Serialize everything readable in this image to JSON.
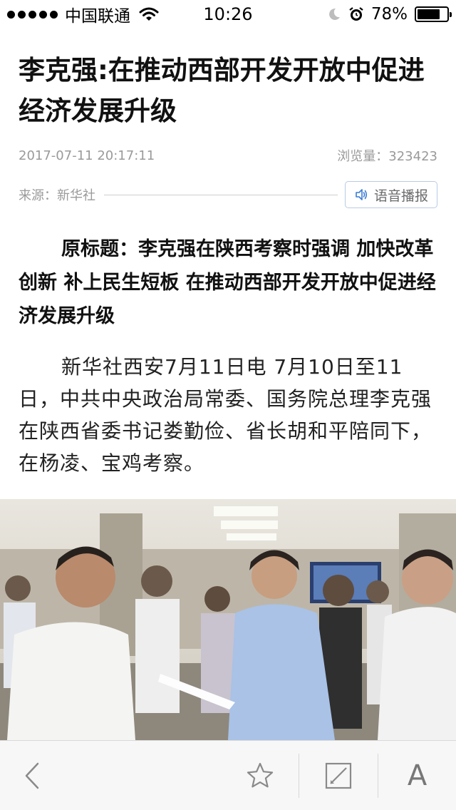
{
  "status_bar": {
    "carrier": "中国联通",
    "time": "10:26",
    "battery_percent": "78%",
    "battery_level": 0.78
  },
  "article": {
    "title": "李克强:在推动西部开发开放中促进经济发展升级",
    "datetime": "2017-07-11 20:17:11",
    "views_label": "浏览量：",
    "views_count": "323423",
    "source": "来源：新华社",
    "voice_button_label": "语音播报",
    "original_title": "原标题：李克强在陕西考察时强调 加快改革创新 补上民生短板 在推动西部开发开放中促进经济发展升级",
    "paragraph": "新华社西安7月11日电 7月10日至11日，中共中央政治局常委、国务院总理李克强在陕西省委书记娄勤俭、省长胡和平陪同下，在杨凌、宝鸡考察。"
  },
  "bottom_bar": {
    "font_size_label": "A"
  },
  "icons": {
    "back": "chevron-left-icon",
    "favorite": "star-icon",
    "edit": "edit-icon",
    "speaker": "speaker-icon"
  }
}
